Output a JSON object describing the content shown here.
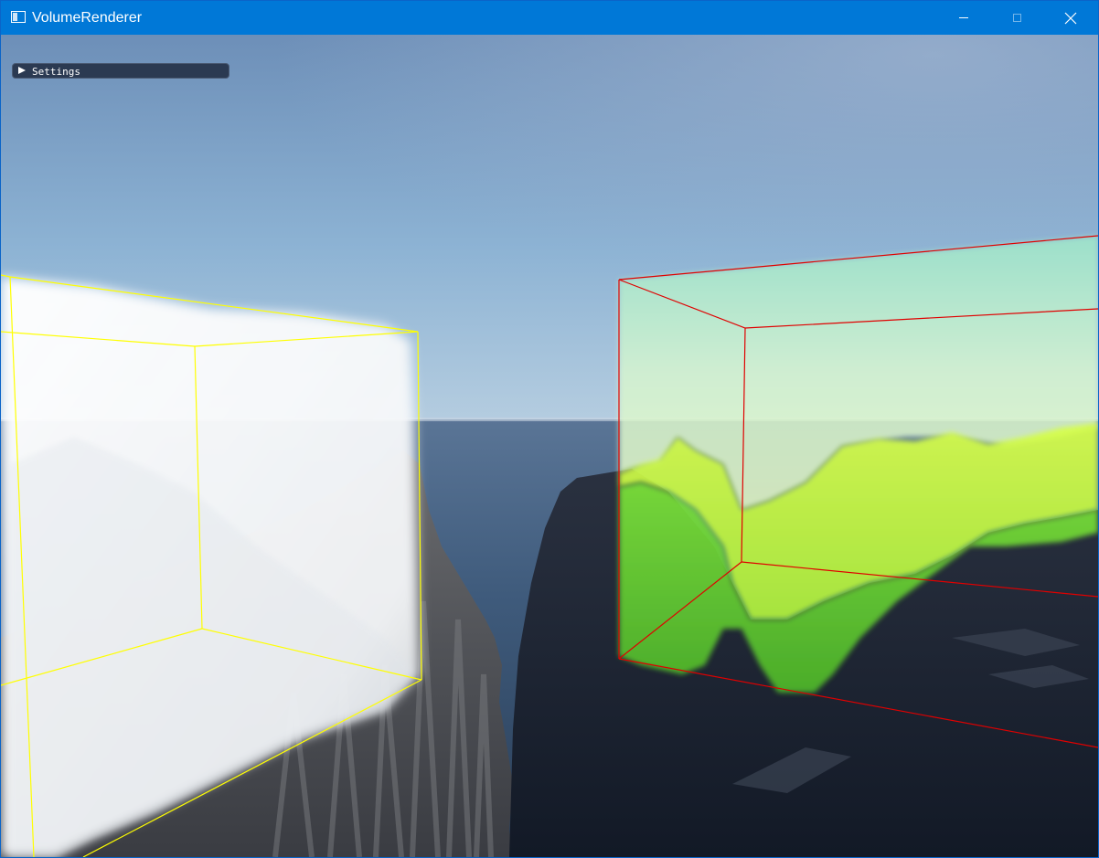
{
  "window": {
    "title": "VolumeRenderer",
    "icon": "app-window-icon",
    "controls": [
      "minimize-icon",
      "maximize-icon",
      "close-icon"
    ]
  },
  "colors": {
    "titlebar": "#0078d7",
    "settings_panel": "#2b3a52",
    "left_volume_bounds": "#ffff00",
    "right_volume_bounds": "#e00000"
  },
  "settings": {
    "label": "Settings",
    "expanded": false
  }
}
